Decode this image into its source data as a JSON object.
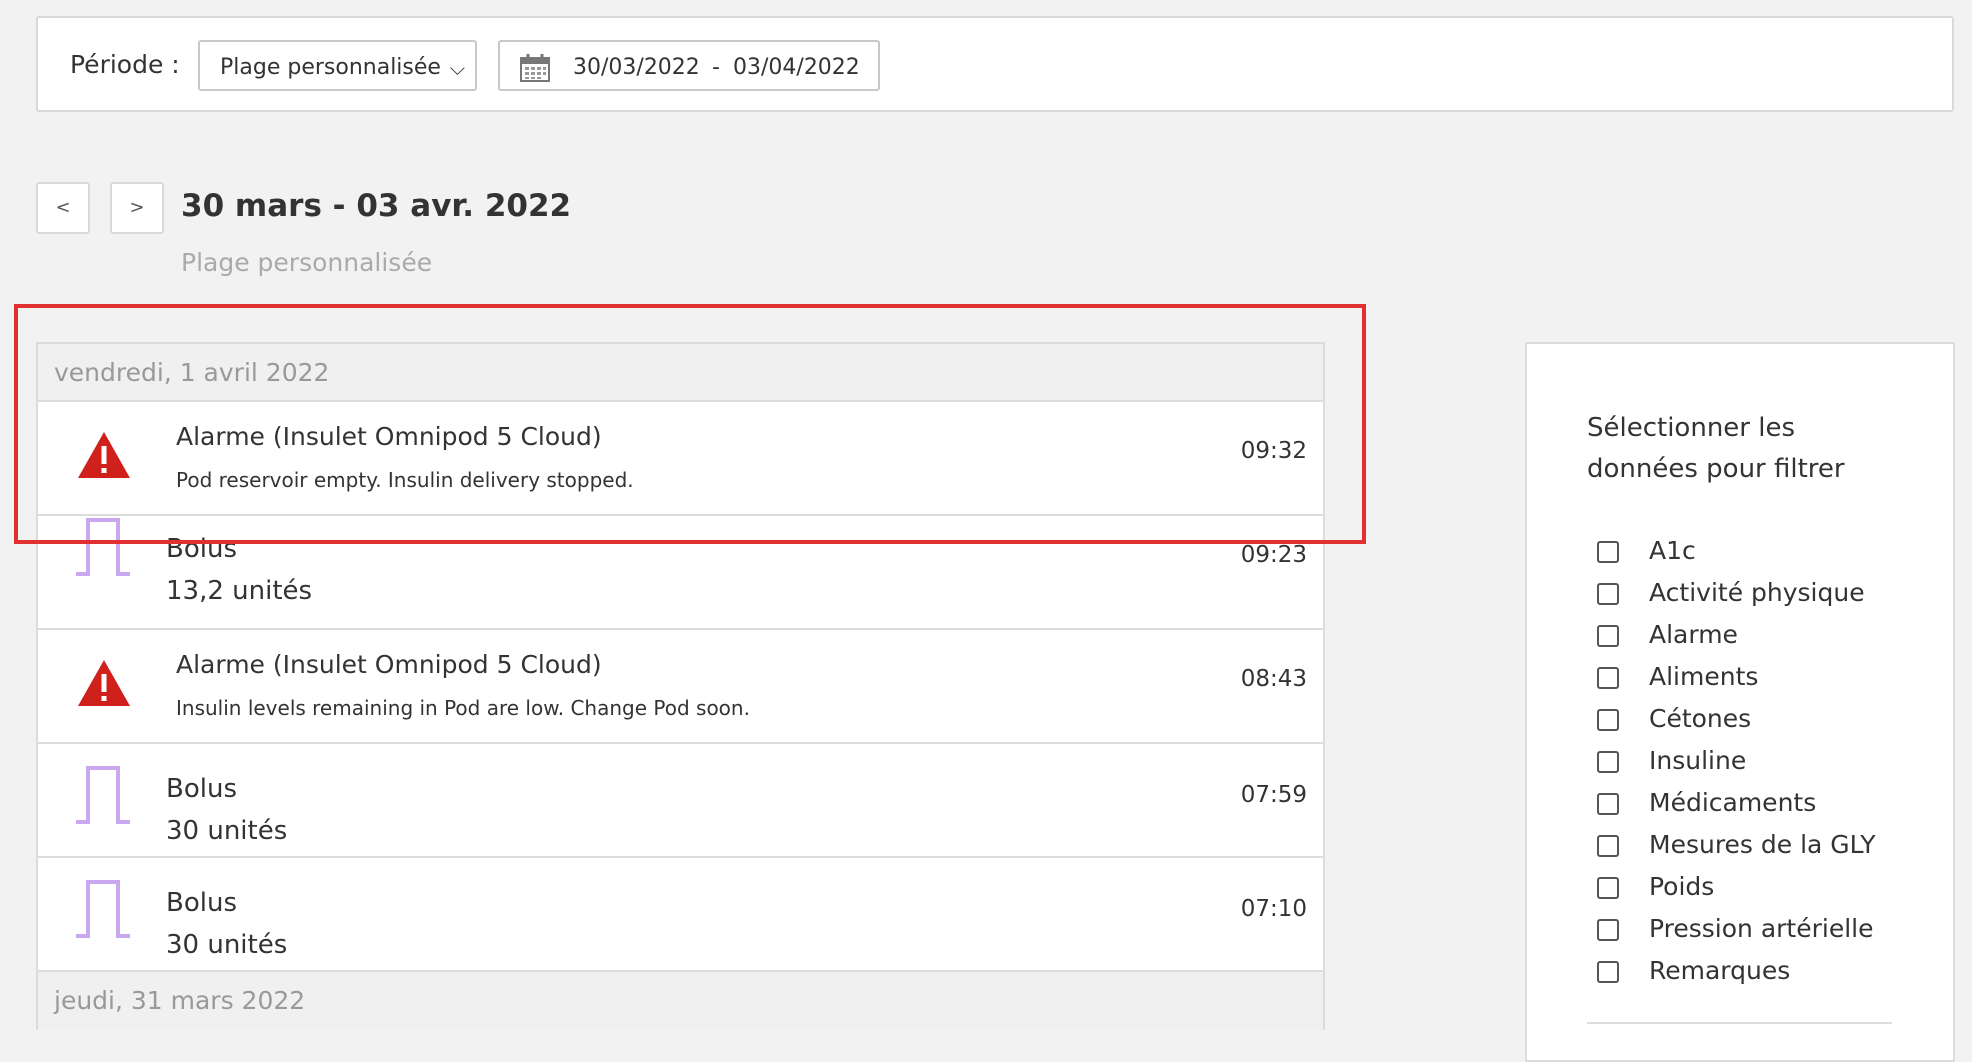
{
  "header": {
    "period_label": "Période :",
    "period_select_value": "Plage personnalisée",
    "date_start": "30/03/2022",
    "date_separator": "-",
    "date_end": "03/04/2022"
  },
  "navigation": {
    "prev_label": "<",
    "next_label": ">",
    "range_title": "30 mars - 03 avr. 2022",
    "range_subtitle": "Plage personnalisée"
  },
  "days": [
    {
      "date": "vendredi, 1 avril 2022",
      "events": [
        {
          "type": "alarm",
          "icon": "alarm-warning-icon",
          "title": "Alarme (Insulet Omnipod 5 Cloud)",
          "description": "Pod reservoir empty. Insulin delivery stopped.",
          "time": "09:32"
        },
        {
          "type": "bolus",
          "icon": "bolus-icon",
          "title": "Bolus",
          "description": "13,2 unités",
          "time": "09:23"
        },
        {
          "type": "alarm",
          "icon": "alarm-warning-icon",
          "title": "Alarme (Insulet Omnipod 5 Cloud)",
          "description": "Insulin levels remaining in Pod are low. Change Pod soon.",
          "time": "08:43"
        },
        {
          "type": "bolus",
          "icon": "bolus-icon",
          "title": "Bolus",
          "description": "30 unités",
          "time": "07:59"
        },
        {
          "type": "bolus",
          "icon": "bolus-icon",
          "title": "Bolus",
          "description": "30 unités",
          "time": "07:10"
        }
      ]
    },
    {
      "date": "jeudi, 31 mars 2022",
      "events": []
    }
  ],
  "filter": {
    "title": "Sélectionner les données pour filtrer",
    "options": [
      {
        "label": "A1c",
        "checked": false
      },
      {
        "label": "Activité physique",
        "checked": false
      },
      {
        "label": "Alarme",
        "checked": false
      },
      {
        "label": "Aliments",
        "checked": false
      },
      {
        "label": "Cétones",
        "checked": false
      },
      {
        "label": "Insuline",
        "checked": false
      },
      {
        "label": "Médicaments",
        "checked": false
      },
      {
        "label": "Mesures de la GLY",
        "checked": false
      },
      {
        "label": "Poids",
        "checked": false
      },
      {
        "label": "Pression artérielle",
        "checked": false
      },
      {
        "label": "Remarques",
        "checked": false
      }
    ]
  },
  "colors": {
    "alarm_red": "#d0201c",
    "bolus_purple": "#c9a8f0",
    "highlight_red": "#e03030"
  }
}
